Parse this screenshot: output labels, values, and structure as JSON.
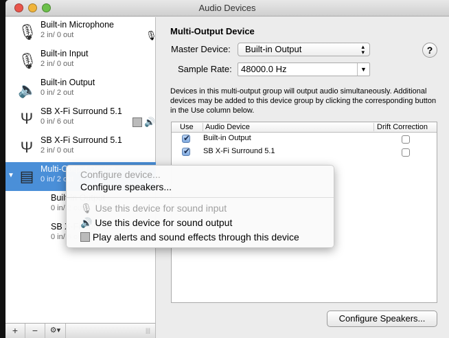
{
  "window": {
    "title": "Audio Devices"
  },
  "sidebar": {
    "devices": [
      {
        "name": "Built-in Microphone",
        "io": "2 in/ 0 out",
        "icon": "microphone-icon",
        "badges": [
          "microphone-icon"
        ]
      },
      {
        "name": "Built-in Input",
        "io": "2 in/ 0 out",
        "icon": "microphone-icon",
        "badges": []
      },
      {
        "name": "Built-in Output",
        "io": "0 in/ 2 out",
        "icon": "speaker-icon",
        "badges": []
      },
      {
        "name": "SB X-Fi Surround 5.1",
        "io": "0 in/ 6 out",
        "icon": "usb-icon",
        "badges": [
          "finder-icon",
          "speaker-icon"
        ]
      },
      {
        "name": "SB X-Fi Surround 5.1",
        "io": "2 in/ 0 out",
        "icon": "usb-icon",
        "badges": []
      },
      {
        "name": "Multi-Output Device",
        "io": "0 in/ 2 out",
        "icon": "multi-output-icon",
        "selected": true,
        "expanded": true
      },
      {
        "name": "Built-in Output",
        "io": "0 in/ 2 out",
        "child": true
      },
      {
        "name": "SB X-Fi Surround 5.1",
        "io": "0 in/ 6 out",
        "child": true
      }
    ],
    "bottom": {
      "add": "+",
      "remove": "−",
      "gear": "⚙▾"
    }
  },
  "main": {
    "heading": "Multi-Output Device",
    "master_label": "Master Device:",
    "master_value": "Built-in Output",
    "rate_label": "Sample Rate:",
    "rate_value": "48000.0 Hz",
    "help": "?",
    "description": "Devices in this multi-output group will output audio simultaneously. Additional devices may be added to this device group by clicking the corresponding button in the Use column below.",
    "table": {
      "headers": [
        "Use",
        "Audio Device",
        "Drift Correction"
      ],
      "rows": [
        {
          "use": true,
          "device": "Built-in Output",
          "drift": false
        },
        {
          "use": true,
          "device": "SB X-Fi Surround 5.1",
          "drift": false
        }
      ]
    },
    "configure_speakers": "Configure Speakers..."
  },
  "context_menu": {
    "items": [
      {
        "label": "Configure device...",
        "enabled": false
      },
      {
        "label": "Configure speakers...",
        "enabled": true
      },
      {
        "label": "Use this device for sound input",
        "enabled": false,
        "icon": "microphone-icon"
      },
      {
        "label": "Use this device for sound output",
        "enabled": true,
        "icon": "speaker-icon"
      },
      {
        "label": "Play alerts and sound effects through this device",
        "enabled": true,
        "icon": "finder-icon"
      }
    ]
  },
  "colors": {
    "selection": "#4a8fd8"
  }
}
